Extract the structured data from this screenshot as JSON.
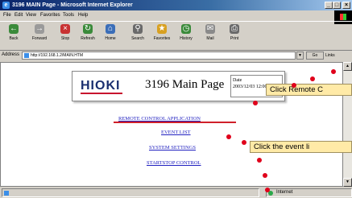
{
  "window": {
    "title": "3196 MAIN Page - Microsoft Internet Explorer",
    "controls": [
      "_",
      "□",
      "×"
    ]
  },
  "menu": [
    "File",
    "Edit",
    "View",
    "Favorites",
    "Tools",
    "Help"
  ],
  "toolbar": [
    {
      "label": "Back",
      "icon": "back-arrow-icon"
    },
    {
      "label": "Forward",
      "icon": "forward-arrow-icon"
    },
    {
      "label": "Stop",
      "icon": "stop-icon"
    },
    {
      "label": "Refresh",
      "icon": "refresh-icon"
    },
    {
      "label": "Home",
      "icon": "home-icon"
    },
    {
      "label": "Search",
      "icon": "search-icon"
    },
    {
      "label": "Favorites",
      "icon": "favorites-icon"
    },
    {
      "label": "History",
      "icon": "history-icon"
    },
    {
      "label": "Mail",
      "icon": "mail-icon"
    },
    {
      "label": "Print",
      "icon": "print-icon"
    }
  ],
  "address": {
    "label": "Address",
    "url": "http://192.168.1.2/MAIN.HTM",
    "go_label": "Go",
    "links_label": "Links"
  },
  "page": {
    "logo": "HIOKI",
    "title": "3196 Main Page",
    "date_label": "Date",
    "date_value": "2003/12/03 12:00:16",
    "nav": [
      "REMOTE CONTROL APPLICATION",
      "EVENT LIST",
      "SYSTEM SETTINGS",
      "STARTSTOP CONTROL"
    ]
  },
  "status": {
    "zone": "Internet"
  },
  "callouts": {
    "remote": "Click Remote C",
    "event": "Click the event li"
  },
  "colors": {
    "titlebar": "#0a246a",
    "link": "#2020c0",
    "callout_bg": "#ffeaa7",
    "callout_dot": "#e0001b",
    "underline_red": "#d0202a"
  }
}
